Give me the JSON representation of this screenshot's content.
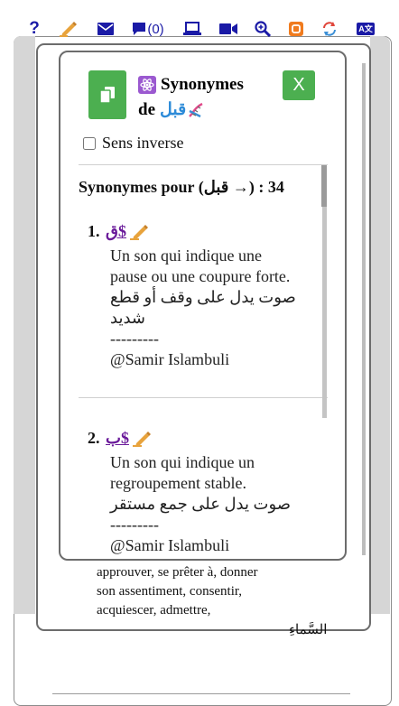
{
  "toolbar": {
    "items": [
      {
        "name": "help-icon",
        "glyph": "?"
      },
      {
        "name": "edit-icon"
      },
      {
        "name": "mail-icon"
      },
      {
        "name": "comments-icon",
        "count": "(0)"
      },
      {
        "name": "laptop-icon"
      },
      {
        "name": "video-icon"
      },
      {
        "name": "zoom-icon"
      },
      {
        "name": "blogger-icon"
      },
      {
        "name": "refresh-icon"
      },
      {
        "name": "translate-icon",
        "glyph": "A文"
      }
    ]
  },
  "dialog": {
    "title_word": "Synonymes",
    "title_de": "de",
    "title_arabic": "قبل",
    "close_label": "X",
    "inverse_label": "Sens inverse",
    "list_header": "Synonymes pour (قبل →) : 34",
    "entries": [
      {
        "num": "1.",
        "link": "$ق",
        "fr_line1": "Un son qui indique une",
        "fr_line2": "pause ou une coupure forte.",
        "ar": "صوت يدل على وقف أو قطع شديد",
        "dashes": "---------",
        "author": "@Samir Islambuli"
      },
      {
        "num": "2.",
        "link": "$ب",
        "fr_line1": "Un son qui indique un",
        "fr_line2": "regroupement stable.",
        "ar": "صوت يدل على جمع مستقر",
        "dashes": "---------",
        "author": "@Samir Islambuli"
      }
    ]
  },
  "background": {
    "text_lines": [
      "approuver, se prêter à, donner",
      "son assentiment, consentir,",
      "acquiescer, admettre,"
    ],
    "arabic": "السَّماءِ"
  },
  "colors": {
    "accent_green": "#4caf50",
    "toolbar_blue": "#1a1aa6",
    "link_purple": "#6a1a9a",
    "arabic_blue": "#2d8bd8"
  }
}
